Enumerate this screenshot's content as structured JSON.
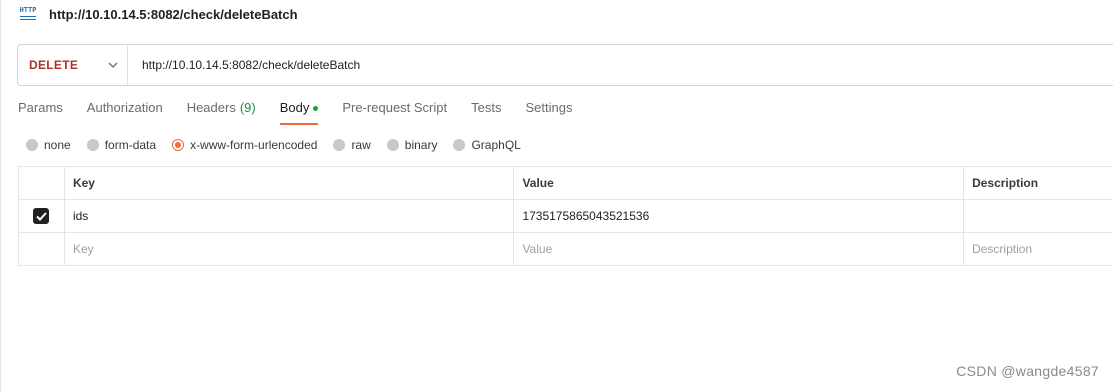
{
  "header": {
    "badge_text": "HTTP",
    "title": "http://10.10.14.5:8082/check/deleteBatch"
  },
  "request": {
    "method": "DELETE",
    "url": "http://10.10.14.5:8082/check/deleteBatch",
    "method_color": "#a6332b"
  },
  "tabs": [
    {
      "label": "Params"
    },
    {
      "label": "Authorization"
    },
    {
      "label": "Headers",
      "count": "(9)"
    },
    {
      "label": "Body",
      "active": true
    },
    {
      "label": "Pre-request Script"
    },
    {
      "label": "Tests"
    },
    {
      "label": "Settings"
    }
  ],
  "body_types": [
    {
      "label": "none"
    },
    {
      "label": "form-data"
    },
    {
      "label": "x-www-form-urlencoded",
      "selected": true
    },
    {
      "label": "raw"
    },
    {
      "label": "binary"
    },
    {
      "label": "GraphQL"
    }
  ],
  "table": {
    "headers": {
      "key": "Key",
      "value": "Value",
      "description": "Description"
    },
    "rows": [
      {
        "checked": true,
        "key": "ids",
        "value": "1735175865043521536",
        "description": ""
      }
    ],
    "placeholder": {
      "key": "Key",
      "value": "Value",
      "description": "Description"
    }
  },
  "watermark": "CSDN @wangde4587",
  "accent_color": "#f26b3a"
}
